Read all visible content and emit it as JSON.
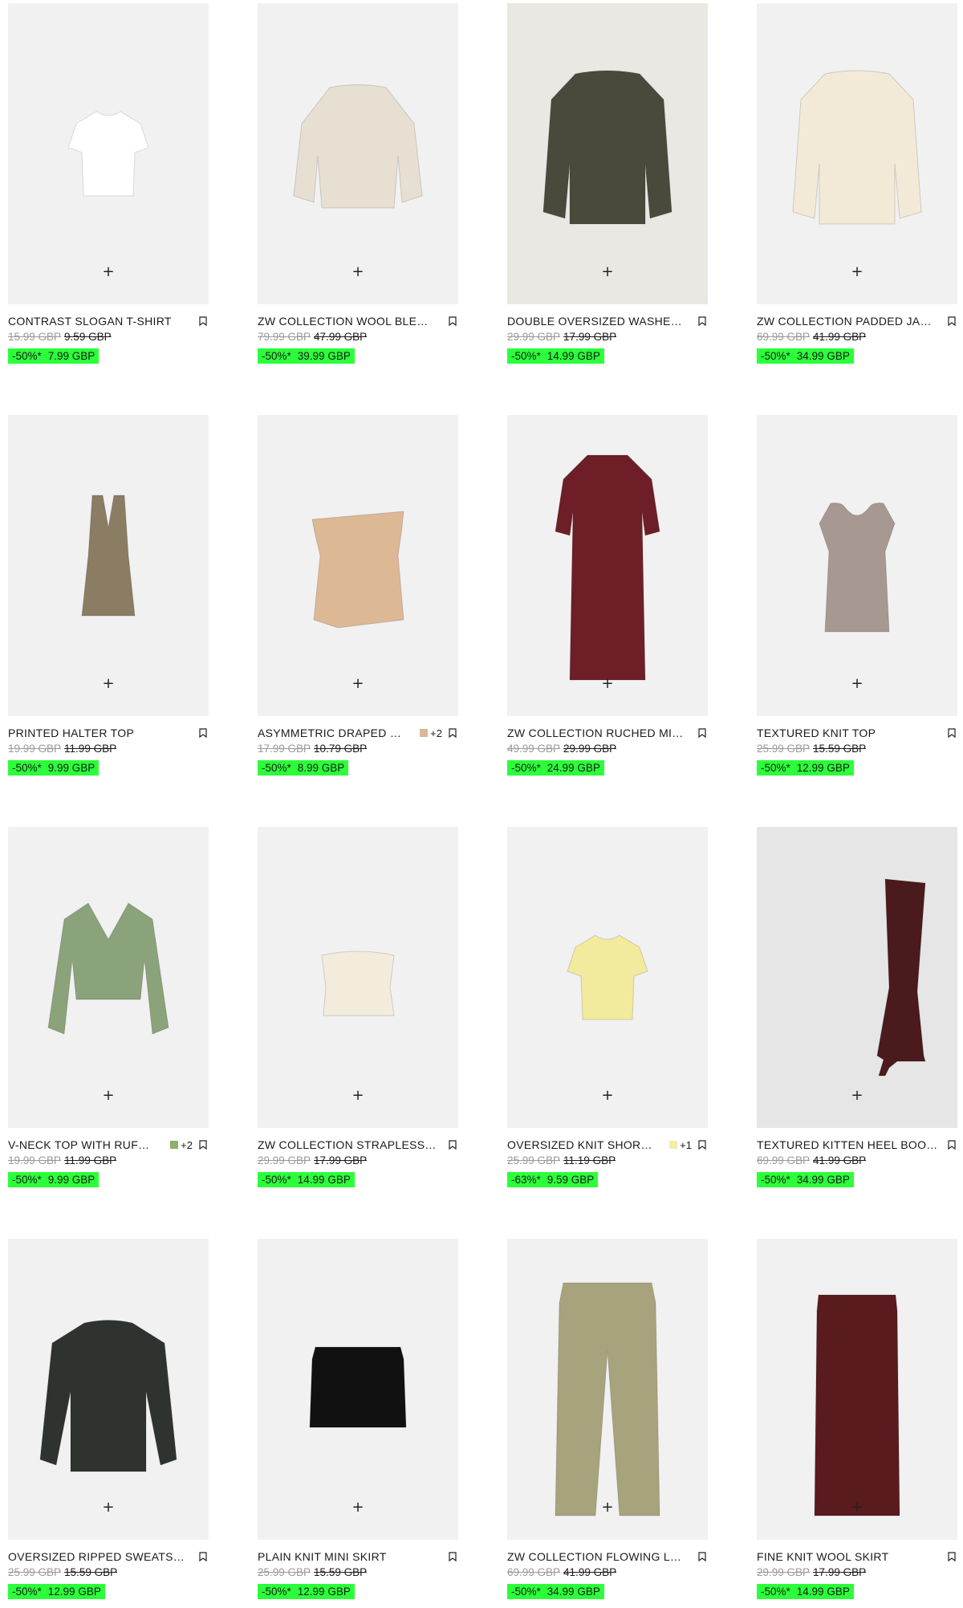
{
  "ui": {
    "quick_add_symbol": "+"
  },
  "colors": {
    "sale_badge": "#2bff3a",
    "image_bg": "#f1f1f1"
  },
  "products": [
    {
      "name": "CONTRAST SLOGAN T-SHIRT",
      "original_price": "15.99 GBP",
      "previous_price": "9.59 GBP",
      "discount": "-50%*",
      "sale_price": "7.99 GBP",
      "art": "tshirt",
      "fill": "#ffffff",
      "bg": "#f1f1f1"
    },
    {
      "name": "ZW COLLECTION WOOL BLE…",
      "original_price": "79.99 GBP",
      "previous_price": "47.99 GBP",
      "discount": "-50%*",
      "sale_price": "39.99 GBP",
      "art": "top",
      "fill": "#e7dfd2",
      "bg": "#f1f1f1"
    },
    {
      "name": "DOUBLE OVERSIZED WASHE…",
      "original_price": "29.99 GBP",
      "previous_price": "17.99 GBP",
      "discount": "-50%*",
      "sale_price": "14.99 GBP",
      "art": "jacket",
      "fill": "#4a4a3c",
      "bg": "#e9e8e2"
    },
    {
      "name": "ZW COLLECTION PADDED JA…",
      "original_price": "69.99 GBP",
      "previous_price": "41.99 GBP",
      "discount": "-50%*",
      "sale_price": "34.99 GBP",
      "art": "jacket",
      "fill": "#f2ead7",
      "bg": "#f1f1f1"
    },
    {
      "name": "PRINTED HALTER TOP",
      "original_price": "19.99 GBP",
      "previous_price": "11.99 GBP",
      "discount": "-50%*",
      "sale_price": "9.99 GBP",
      "art": "halter",
      "fill": "#8b7d63",
      "bg": "#f1f1f1"
    },
    {
      "name": "ASYMMETRIC DRAPED …",
      "swatch": "#d7b99a",
      "more_colors": "+2",
      "original_price": "17.99 GBP",
      "previous_price": "10.79 GBP",
      "discount": "-50%*",
      "sale_price": "8.99 GBP",
      "art": "drape",
      "fill": "#ddb895",
      "bg": "#f1f1f1"
    },
    {
      "name": "ZW COLLECTION RUCHED MI…",
      "original_price": "49.99 GBP",
      "previous_price": "29.99 GBP",
      "discount": "-50%*",
      "sale_price": "24.99 GBP",
      "art": "dress",
      "fill": "#6e1e27",
      "bg": "#f1f1f1"
    },
    {
      "name": "TEXTURED KNIT TOP",
      "original_price": "25.99 GBP",
      "previous_price": "15.59 GBP",
      "discount": "-50%*",
      "sale_price": "12.99 GBP",
      "art": "knittop",
      "fill": "#a89892",
      "bg": "#f1f1f1"
    },
    {
      "name": "V-NECK TOP WITH RUF…",
      "swatch": "#8eae6e",
      "more_colors": "+2",
      "original_price": "19.99 GBP",
      "previous_price": "11.99 GBP",
      "discount": "-50%*",
      "sale_price": "9.99 GBP",
      "art": "blouse",
      "fill": "#8aa37a",
      "bg": "#f1f1f1"
    },
    {
      "name": "ZW COLLECTION STRAPLESS…",
      "original_price": "29.99 GBP",
      "previous_price": "17.99 GBP",
      "discount": "-50%*",
      "sale_price": "14.99 GBP",
      "art": "tube",
      "fill": "#f3ecdc",
      "bg": "#f1f1f1"
    },
    {
      "name": "OVERSIZED KNIT SHOR…",
      "swatch": "#f3ecaa",
      "more_colors": "+1",
      "original_price": "25.99 GBP",
      "previous_price": "11.19 GBP",
      "discount": "-63%*",
      "sale_price": "9.59 GBP",
      "art": "tshirt",
      "fill": "#f2ea9c",
      "bg": "#f1f1f1"
    },
    {
      "name": "TEXTURED KITTEN HEEL BOO…",
      "original_price": "69.99 GBP",
      "previous_price": "41.99 GBP",
      "discount": "-50%*",
      "sale_price": "34.99 GBP",
      "art": "boot",
      "fill": "#4a1a1c",
      "bg": "#e6e6e6"
    },
    {
      "name": "OVERSIZED RIPPED SWEATS…",
      "original_price": "25.99 GBP",
      "previous_price": "15.59 GBP",
      "discount": "-50%*",
      "sale_price": "12.99 GBP",
      "art": "sweat",
      "fill": "#2f3330",
      "bg": "#f1f1f1"
    },
    {
      "name": "PLAIN KNIT MINI SKIRT",
      "original_price": "25.99 GBP",
      "previous_price": "15.59 GBP",
      "discount": "-50%*",
      "sale_price": "12.99 GBP",
      "art": "mini",
      "fill": "#111111",
      "bg": "#f1f1f1"
    },
    {
      "name": "ZW COLLECTION FLOWING L…",
      "original_price": "69.99 GBP",
      "previous_price": "41.99 GBP",
      "discount": "-50%*",
      "sale_price": "34.99 GBP",
      "art": "pants",
      "fill": "#a7a37c",
      "bg": "#f1f1f1"
    },
    {
      "name": "FINE KNIT WOOL SKIRT",
      "original_price": "29.99 GBP",
      "previous_price": "17.99 GBP",
      "discount": "-50%*",
      "sale_price": "14.99 GBP",
      "art": "skirt",
      "fill": "#5a1b1e",
      "bg": "#f1f1f1"
    }
  ]
}
